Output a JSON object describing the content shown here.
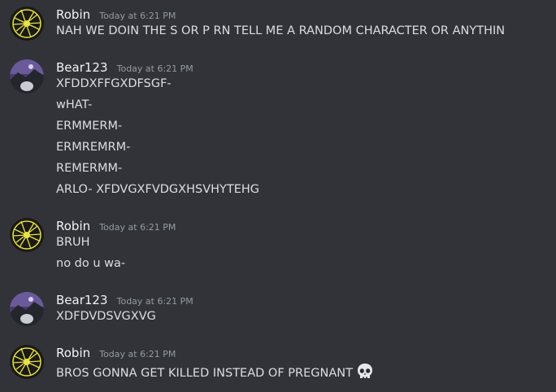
{
  "messages": [
    {
      "author": "Robin",
      "timestamp": "Today at 6:21 PM",
      "lines": [
        "NAH WE DOIN THE S OR P RN TELL ME A RANDOM CHARACTER OR ANYTHIN"
      ]
    },
    {
      "author": "Bear123",
      "timestamp": "Today at 6:21 PM",
      "lines": [
        "XFDDXFFGXDFSGF-",
        "wHAT-",
        "ERMMERM-",
        "ERMREMRM-",
        "REMERMM-",
        "ARLO- XFDVGXFVDGXHSVHYTEHG"
      ]
    },
    {
      "author": "Robin",
      "timestamp": "Today at 6:21 PM",
      "lines": [
        "BRUH",
        "no do u wa-"
      ]
    },
    {
      "author": "Bear123",
      "timestamp": "Today at 6:21 PM",
      "lines": [
        "XDFDVDSVGXVG"
      ]
    },
    {
      "author": "Robin",
      "timestamp": "Today at 6:21 PM",
      "lines": [
        "BROS GONNA GET KILLED INSTEAD OF PREGNANT"
      ],
      "emoji": "skull-emoji"
    }
  ],
  "colors": {
    "background": "#313338",
    "username": "#f2f3f5",
    "timestamp": "#949ba4",
    "text": "#dbdee1"
  }
}
